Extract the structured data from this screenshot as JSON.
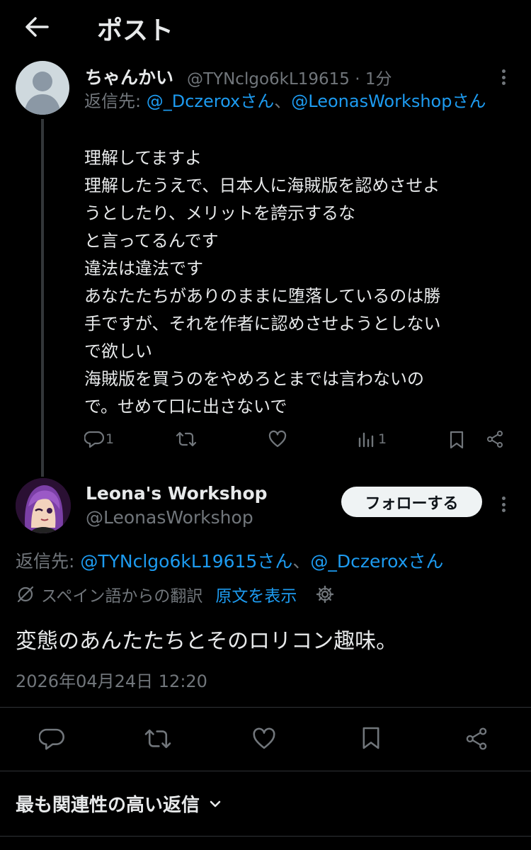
{
  "header": {
    "title": "ポスト",
    "back_icon": "arrow-left-icon"
  },
  "reply": {
    "display_name": "ちゃんかい",
    "handle_time": "@TYNclgo6kL19615 · 1分",
    "reply_prefix": "返信先: ",
    "mention_1": "@_Dczeroxさん",
    "separator": "、",
    "mention_2": "@LeonasWorkshopさん",
    "lines": [
      "理解してますよ",
      "理解したうえで、日本人に海賊版を認めさせよ",
      "うとしたり、メリットを誇示するな",
      "と言ってるんです",
      "違法は違法です",
      "あなたたちがありのままに堕落しているのは勝",
      "手ですが、それを作者に認めさせようとしない",
      "で欲しい",
      "海賊版を買うのをやめろとまでは言わないの",
      "で。せめて口に出さないで"
    ],
    "reply_count": "1",
    "views_count": "1"
  },
  "main": {
    "display_name": "Leona's Workshop",
    "handle": "@LeonasWorkshop",
    "follow_label": "フォローする",
    "reply_prefix": "返信先: ",
    "mention_1": "@TYNclgo6kL19615さん",
    "separator": "、",
    "mention_2": "@_Dczeroxさん",
    "translated_from": "スペイン語からの翻訳",
    "show_original": "原文を表示",
    "text": "変態のあんたたちとそのロリコン趣味。",
    "timestamp": "2026年04月24日 12:20"
  },
  "relevance": {
    "label": "最も関連性の高い返信"
  },
  "colors": {
    "background": "#000000",
    "text": "#e7e9ea",
    "muted": "#71767b",
    "link": "#1d9bf0",
    "divider": "#2f3336"
  }
}
